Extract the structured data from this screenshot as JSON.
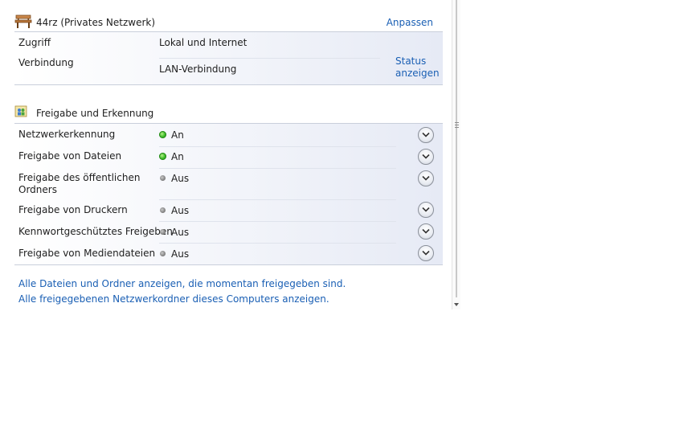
{
  "network": {
    "name": "44rz (Privates Netzwerk)",
    "customize_link": "Anpassen",
    "rows": [
      {
        "label": "Zugriff",
        "value": "Lokal und Internet"
      },
      {
        "label": "Verbindung",
        "value": "LAN-Verbindung"
      }
    ],
    "status_link_line1": "Status",
    "status_link_line2": "anzeigen"
  },
  "sharing": {
    "heading": "Freigabe und Erkennung",
    "items": [
      {
        "label": "Netzwerkerkennung",
        "state": "An",
        "on": true
      },
      {
        "label": "Freigabe von Dateien",
        "state": "An",
        "on": true
      },
      {
        "label_line1": "Freigabe des öffentlichen",
        "label_line2": "Ordners",
        "state": "Aus",
        "on": false
      },
      {
        "label": "Freigabe von Druckern",
        "state": "Aus",
        "on": false
      },
      {
        "label": "Kennwortgeschütztes Freigeben",
        "state": "Aus",
        "on": false
      },
      {
        "label": "Freigabe von Mediendateien",
        "state": "Aus",
        "on": false
      }
    ]
  },
  "links": {
    "show_shared_files": "Alle Dateien und Ordner anzeigen, die momentan freigegeben sind.",
    "show_shared_folders": "Alle freigegebenen Netzwerkordner dieses Computers anzeigen."
  },
  "icons": {
    "network": "park-bench-icon",
    "sharing": "sharing-users-icon",
    "expand": "chevron-down-icon"
  },
  "colors": {
    "link": "#1a5fb4",
    "status_on": "#3fbf2a",
    "status_off": "#8a8a8a"
  }
}
